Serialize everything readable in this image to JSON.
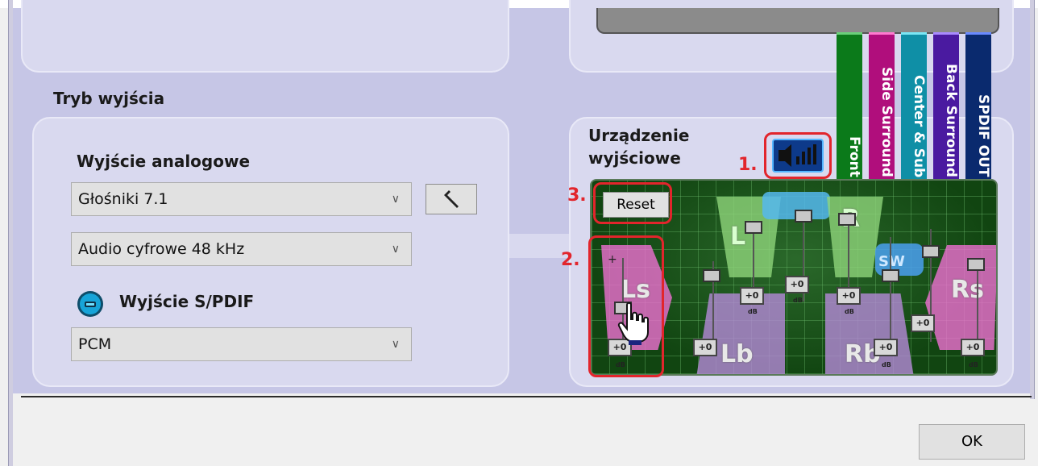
{
  "output_mode": {
    "title": "Tryb wyjścia",
    "analog_label": "Wyjście analogowe",
    "speakers_select": "Głośniki 7.1",
    "format_select": "Audio cyfrowe 48 kHz",
    "spdif_label": "Wyjście S/PDIF",
    "spdif_select": "PCM"
  },
  "device": {
    "label_line1": "Urządzenie",
    "label_line2": "wyjściowe",
    "reset_label": "Reset"
  },
  "channels": [
    {
      "label": "Front",
      "color": "#0b7a1a"
    },
    {
      "label": "Side Surround",
      "color": "#b00e7c"
    },
    {
      "label": "Center & Sub",
      "color": "#0f8fa6"
    },
    {
      "label": "Back Surround",
      "color": "#4a1aa0"
    },
    {
      "label": "SPDIF OUT",
      "color": "#0a2a6e"
    }
  ],
  "speakers": {
    "L": "L",
    "R": "R",
    "Ls": "Ls",
    "Rs": "Rs",
    "Lb": "Lb",
    "Rb": "Rb",
    "SW": "SW"
  },
  "levels": {
    "plus": "+",
    "minus": "−",
    "db_value": "+0",
    "db_unit": "dB"
  },
  "callouts": {
    "one": "1.",
    "two": "2.",
    "three": "3."
  },
  "ok_label": "OK",
  "icons": {
    "spdif": "spdif-output-icon",
    "tool": "speaker-settings-icon",
    "device": "speaker-volume-icon",
    "cursor": "hand-cursor-icon"
  }
}
